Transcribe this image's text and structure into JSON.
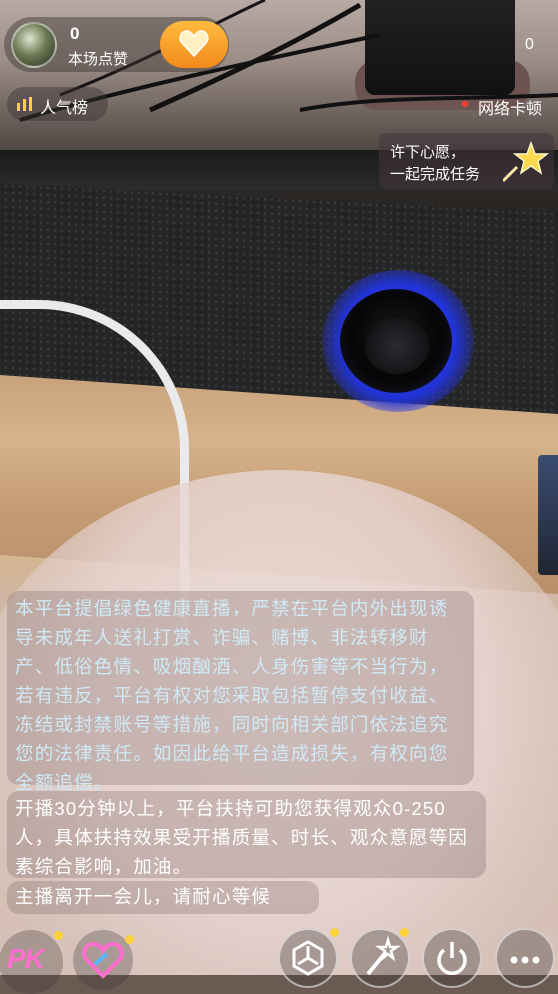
{
  "host": {
    "likes_count": "0",
    "likes_label": "本场点赞"
  },
  "viewers": {
    "count": "0"
  },
  "popularity": {
    "label": "人气榜"
  },
  "network": {
    "status": "网络卡顿"
  },
  "wish": {
    "line1": "许下心愿，",
    "line2": "一起完成任务"
  },
  "notices": {
    "policy": "本平台提倡绿色健康直播，严禁在平台内外出现诱导未成年人送礼打赏、诈骗、赌博、非法转移财产、低俗色情、吸烟酗酒、人身伤害等不当行为，若有违反，平台有权对您采取包括暂停支付收益、冻结或封禁账号等措施，同时向相关部门依法追究您的法律责任。如因此给平台造成损失，有权向您全额追偿。",
    "boost": "开播30分钟以上，平台扶持可助您获得观众0-250人，具体扶持效果受开播质量、时长、观众意愿等因素综合影响，加油。",
    "away": "主播离开一会儿，请耐心等候"
  },
  "toolbar": {
    "pk_label": "PK"
  },
  "colors": {
    "policy_text": "#cfe9f6",
    "like_button": "#f7a22a",
    "pk_pink": "#ff6fcf",
    "badge_yellow": "#ffd23a",
    "network_dot": "#ff3b3b"
  },
  "icons": [
    "like-heart-icon",
    "bar-chart-icon",
    "star-icon",
    "pk-icon",
    "heart-outline-icon",
    "share-icon",
    "magic-wand-icon",
    "power-icon",
    "more-icon"
  ]
}
